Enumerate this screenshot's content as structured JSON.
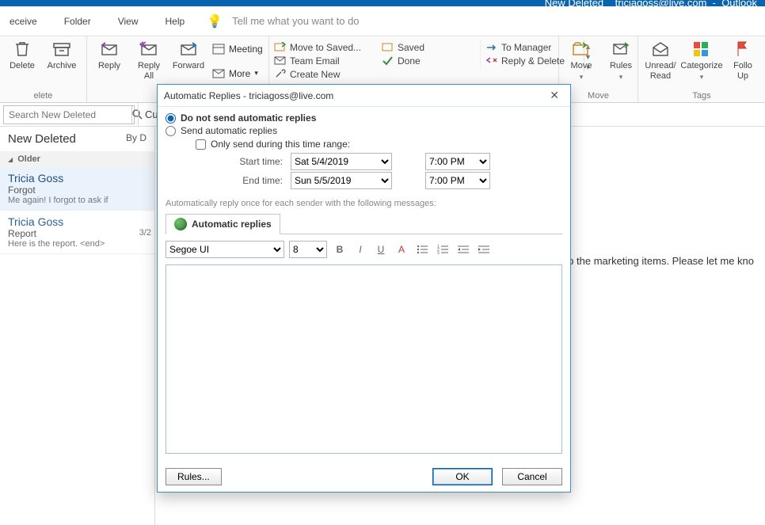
{
  "titlebar": {
    "status": "New Deleted",
    "account": "triciagoss@live.com",
    "appname": "Outlook"
  },
  "menubar": {
    "receive": "eceive",
    "folder": "Folder",
    "view": "View",
    "help": "Help",
    "tellme": "Tell me what you want to do"
  },
  "ribbon": {
    "delete_group_label": "elete",
    "delete": "Delete",
    "archive": "Archive",
    "respond": {
      "reply": "Reply",
      "reply_all_line1": "Reply",
      "reply_all_line2": "All",
      "forward": "Forward",
      "meeting": "Meeting",
      "more": "More"
    },
    "quick": {
      "move_saved": "Move to Saved...",
      "team_email": "Team Email",
      "create_new": "Create New",
      "saved": "Saved",
      "done": "Done",
      "to_manager": "To Manager",
      "reply_delete": "Reply & Delete"
    },
    "move_group_label": "Move",
    "move": "Move",
    "rules": "Rules",
    "tags_group_label": "Tags",
    "unread_l1": "Unread/",
    "unread_l2": "Read",
    "categorize": "Categorize",
    "followup_l1": "Follo",
    "followup_l2": "Up"
  },
  "search": {
    "placeholder": "Search New Deleted",
    "current": "Cu"
  },
  "maillist": {
    "folder": "New Deleted",
    "by": "By D",
    "older": "Older",
    "items": [
      {
        "from": "Tricia Goss",
        "subj": "Forgot",
        "prev": "Me again!  I forgot to ask if"
      },
      {
        "from": "Tricia Goss",
        "subj": "Report",
        "prev": "Here is the report. <end>",
        "date": "3/2"
      }
    ]
  },
  "reading": {
    "snippet": "up the marketing items. Please let me kno"
  },
  "dialog": {
    "title": "Automatic Replies - triciagoss@live.com",
    "opt_no_send": "Do not send automatic replies",
    "opt_send": "Send automatic replies",
    "only_range": "Only send during this time range:",
    "start_label": "Start time:",
    "start_date": "Sat 5/4/2019",
    "start_time": "7:00 PM",
    "end_label": "End time:",
    "end_date": "Sun 5/5/2019",
    "end_time": "7:00 PM",
    "hint": "Automatically reply once for each sender with the following messages:",
    "tab_label": "Automatic replies",
    "font_name": "Segoe UI",
    "font_size": "8",
    "rules_btn": "Rules...",
    "ok": "OK",
    "cancel": "Cancel"
  }
}
